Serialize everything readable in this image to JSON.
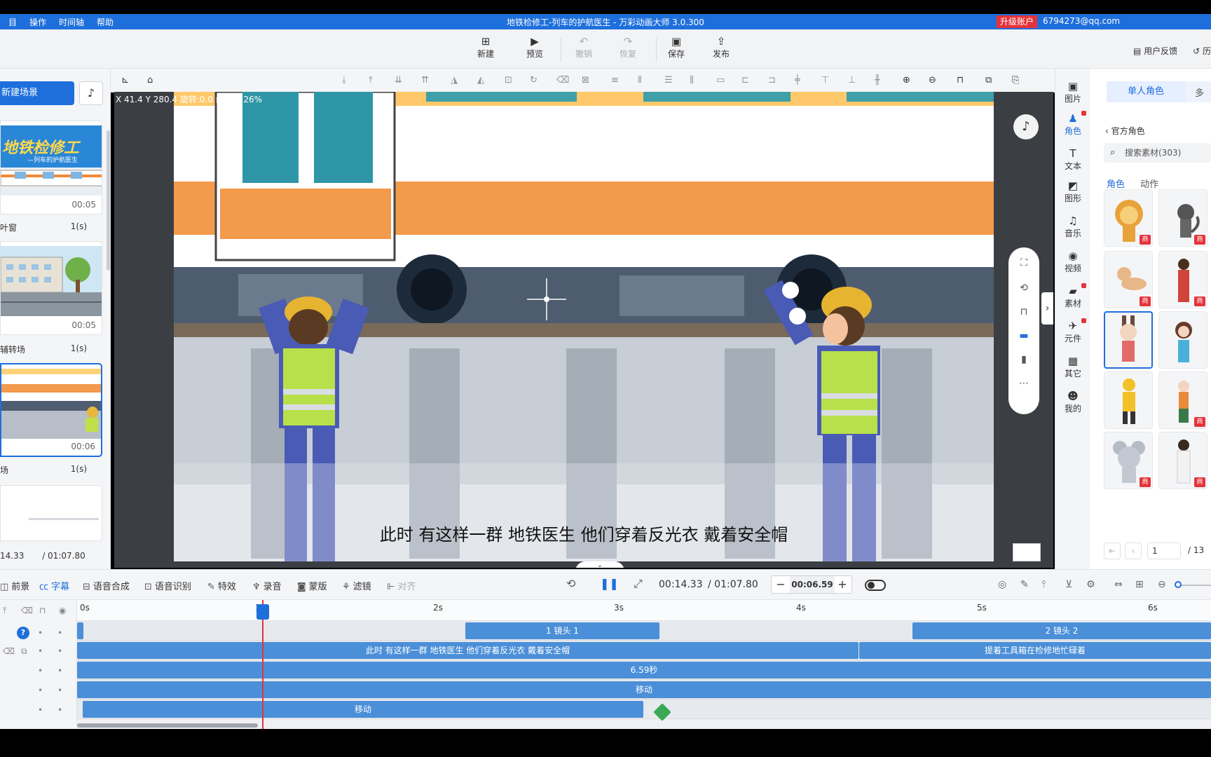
{
  "menubar": {
    "items": [
      "目",
      "操作",
      "时间轴",
      "帮助"
    ],
    "title": "地铁检修工-列车的护航医生 - 万彩动画大师 3.0.300",
    "upgrade": "升级账户",
    "account": "6794273@qq.com"
  },
  "toolbar": {
    "new": "新建",
    "preview": "预览",
    "undo": "撤销",
    "redo": "恢复",
    "save": "保存",
    "publish": "发布",
    "feedback": "用户反馈",
    "history": "历"
  },
  "scenes": {
    "new_scene": "新建场景",
    "items": [
      {
        "duration": "00:05",
        "transition": "叶窗",
        "transition_dur": "1(s)",
        "thumb_title": "地铁检修工",
        "thumb_subtitle": "—列车的护航医生"
      },
      {
        "duration": "00:05",
        "transition": "辅转场",
        "transition_dur": "1(s)"
      },
      {
        "duration": "00:06",
        "transition": "场",
        "transition_dur": "1(s)"
      },
      {
        "duration": ""
      }
    ],
    "current_time": "14.33",
    "total_time": "/ 01:07.80"
  },
  "canvas": {
    "coords": "X 41.4  Y 280.4  旋转:0.0  缩放: 126%",
    "subtitle": "此时 有这样一群  地铁医生  他们穿着反光衣  戴着安全帽"
  },
  "sidenav": {
    "items": [
      {
        "label": "图片",
        "icon": "image-icon"
      },
      {
        "label": "角色",
        "icon": "character-icon"
      },
      {
        "label": "文本",
        "icon": "text-icon"
      },
      {
        "label": "图形",
        "icon": "shape-icon"
      },
      {
        "label": "音乐",
        "icon": "music-icon"
      },
      {
        "label": "视频",
        "icon": "video-icon"
      },
      {
        "label": "素材",
        "icon": "material-icon"
      },
      {
        "label": "元件",
        "icon": "component-icon"
      },
      {
        "label": "其它",
        "icon": "other-icon"
      },
      {
        "label": "我的",
        "icon": "mine-icon"
      }
    ]
  },
  "assets": {
    "tab_single": "单人角色",
    "tab_multi": "多",
    "back": "官方角色",
    "search_placeholder": "搜索素材(303)",
    "sub_role": "角色",
    "sub_action": "动作",
    "badge": "商",
    "page_current": "1",
    "page_total": "/ 13"
  },
  "timeline_bar": {
    "foreground": "前景",
    "subtitle": "字幕",
    "tts": "语音合成",
    "asr": "语音识别",
    "effects": "特效",
    "record": "录音",
    "mask": "蒙版",
    "filter": "滤镜",
    "align": "对齐",
    "current": "00:14.33",
    "total": "/ 01:07.80",
    "zoom_value": "00:06.59"
  },
  "timeline": {
    "ruler": [
      "0s",
      "1",
      "2s",
      "3s",
      "4s",
      "5s",
      "6s"
    ],
    "camera1": "1 镜头 1",
    "camera2": "2 镜头 2",
    "caption1": "此时 有这样一群  地铁医生  他们穿着反光衣  戴着安全帽",
    "caption2": "提着工具箱在检修地忙碌着",
    "duration_clip": "6.59秒",
    "move1": "移动",
    "move2": "移动"
  },
  "colors": {
    "accent": "#1e6fdc",
    "danger": "#e5333b",
    "clip": "#4a8fd8"
  }
}
